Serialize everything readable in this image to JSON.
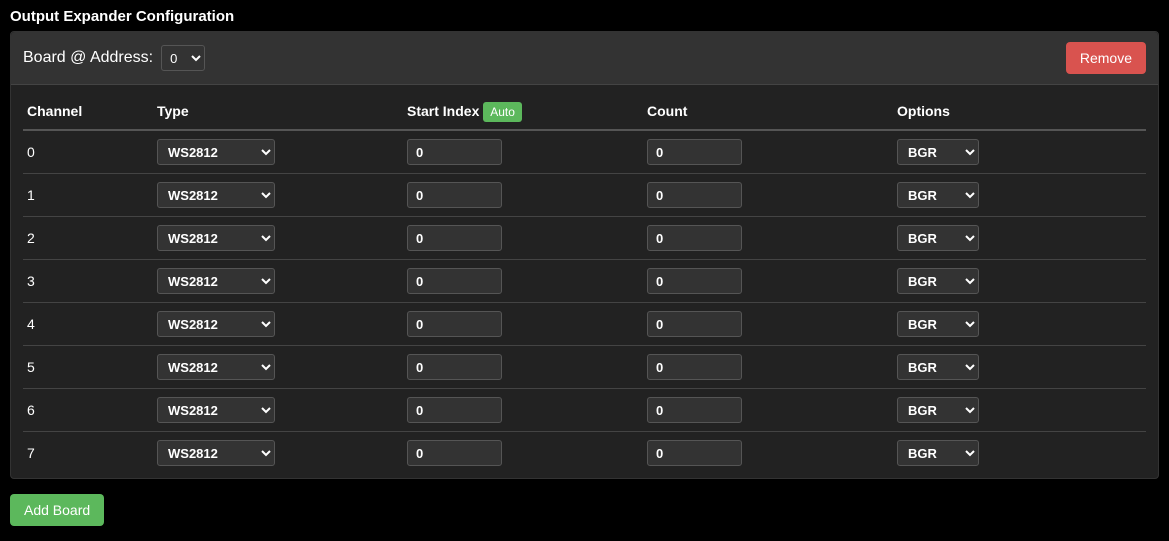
{
  "title": "Output Expander Configuration",
  "board": {
    "label": "Board @ Address:",
    "address_value": "0",
    "remove_label": "Remove"
  },
  "table": {
    "headers": {
      "channel": "Channel",
      "type": "Type",
      "start_index": "Start Index",
      "auto_badge": "Auto",
      "count": "Count",
      "options": "Options"
    },
    "rows": [
      {
        "channel": "0",
        "type": "WS2812",
        "start_index": "0",
        "count": "0",
        "options": "BGR"
      },
      {
        "channel": "1",
        "type": "WS2812",
        "start_index": "0",
        "count": "0",
        "options": "BGR"
      },
      {
        "channel": "2",
        "type": "WS2812",
        "start_index": "0",
        "count": "0",
        "options": "BGR"
      },
      {
        "channel": "3",
        "type": "WS2812",
        "start_index": "0",
        "count": "0",
        "options": "BGR"
      },
      {
        "channel": "4",
        "type": "WS2812",
        "start_index": "0",
        "count": "0",
        "options": "BGR"
      },
      {
        "channel": "5",
        "type": "WS2812",
        "start_index": "0",
        "count": "0",
        "options": "BGR"
      },
      {
        "channel": "6",
        "type": "WS2812",
        "start_index": "0",
        "count": "0",
        "options": "BGR"
      },
      {
        "channel": "7",
        "type": "WS2812",
        "start_index": "0",
        "count": "0",
        "options": "BGR"
      }
    ]
  },
  "add_board_label": "Add Board"
}
